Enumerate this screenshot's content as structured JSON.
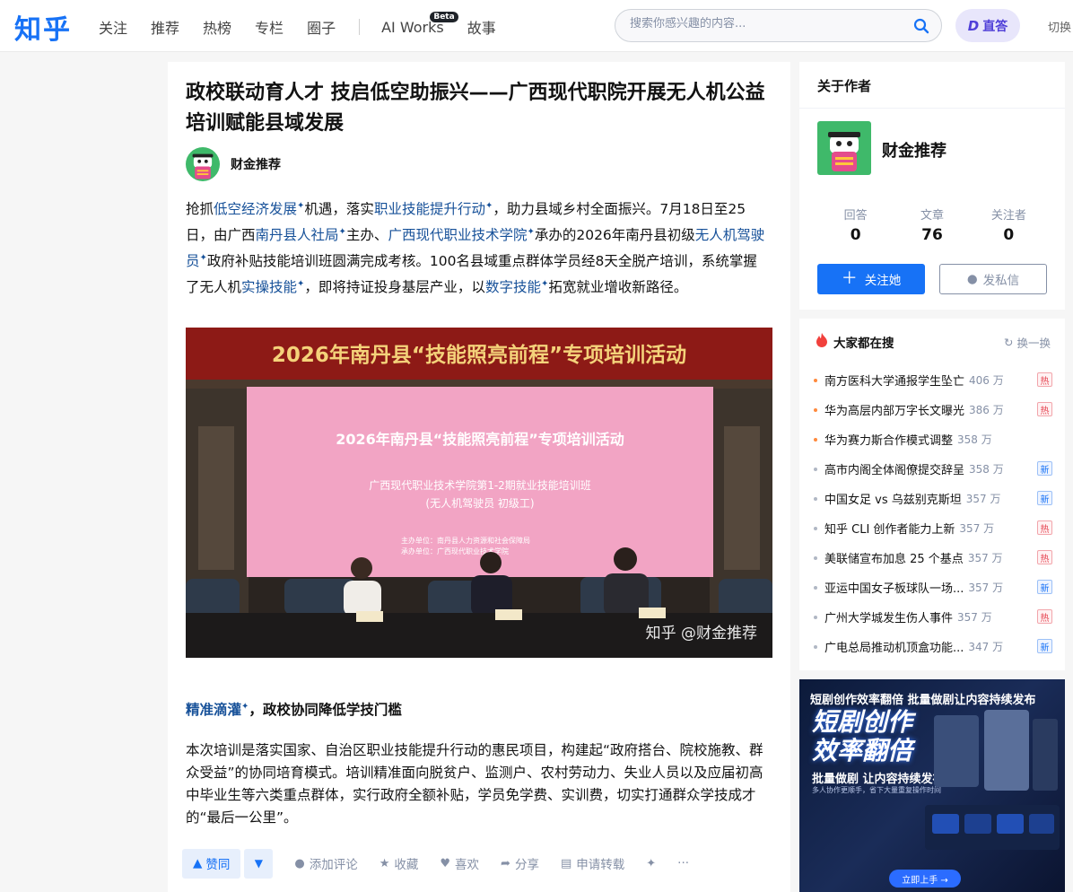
{
  "header": {
    "logo": "知乎",
    "nav": [
      "关注",
      "推荐",
      "热榜",
      "专栏",
      "圈子",
      "AI Works",
      "故事"
    ],
    "beta_badge": "Beta",
    "search_placeholder": "搜索你感兴趣的内容...",
    "zhida_mark": "D",
    "zhida_label": "直答",
    "switch_label": "切换"
  },
  "article": {
    "title": "政校联动育人才 技启低空助振兴——广西现代职院开展无人机公益培训赋能县域发展",
    "author": "财金推荐",
    "p1": [
      {
        "t": "抢抓"
      },
      {
        "t": "低空经济发展",
        "link": true
      },
      {
        "t": "机遇，落实"
      },
      {
        "t": "职业技能提升行动",
        "link": true
      },
      {
        "t": "，助力县域乡村全面振兴。7月18日至25日，由广西"
      },
      {
        "t": "南丹县人社局",
        "link": true
      },
      {
        "t": "主办、"
      },
      {
        "t": "广西现代职业技术学院",
        "link": true
      },
      {
        "t": "承办的2026年南丹县初级"
      },
      {
        "t": "无人机驾驶员",
        "link": true
      },
      {
        "t": "政府补贴技能培训班圆满完成考核。100名县域重点群体学员经8天全脱产培训，系统掌握了无人机"
      },
      {
        "t": "实操技能",
        "link": true
      },
      {
        "t": "，即将持证投身基层产业，以"
      },
      {
        "t": "数字技能",
        "link": true
      },
      {
        "t": "拓宽就业增收新路径。"
      }
    ],
    "photo": {
      "banner": "2026年南丹县“技能照亮前程”专项培训活动",
      "screen_title": "2026年南丹县“技能照亮前程”专项培训活动",
      "screen_line2": "广西现代职业技术学院第1-2期就业技能培训班",
      "screen_line3": "(无人机驾驶员 初级工)",
      "screen_line4": "主办单位：南丹县人力资源和社会保障局",
      "screen_line5": "承办单位：广西现代职业技术学院",
      "watermark": "知乎 @财金推荐"
    },
    "section_link": "精准滴灌",
    "section_rest": "，政校协同降低学技门槛",
    "p2": "本次培训是落实国家、自治区职业技能提升行动的惠民项目，构建起“政府搭台、院校施教、群众受益”的协同培育模式。培训精准面向脱贫户、监测户、农村劳动力、失业人员以及应届初高中毕业生等六类重点群体，实行政府全额补贴，学员免学费、实训费，切实打通群众学技成才的“最后一公里”。",
    "actions": {
      "upvote": "赞同",
      "comment": "添加评论",
      "collect": "收藏",
      "like": "喜欢",
      "share": "分享",
      "repost": "申请转载",
      "more": "···"
    }
  },
  "author_card": {
    "heading": "关于作者",
    "name": "财金推荐",
    "stats": [
      {
        "label": "回答",
        "value": "0"
      },
      {
        "label": "文章",
        "value": "76"
      },
      {
        "label": "关注者",
        "value": "0"
      }
    ],
    "follow": "关注她",
    "message": "发私信"
  },
  "hot": {
    "heading": "大家都在搜",
    "refresh": "换一换",
    "items": [
      {
        "title": "南方医科大学通报学生坠亡",
        "count": "406 万",
        "badge": "热",
        "dot": "#ff8a3d"
      },
      {
        "title": "华为高层内部万字长文曝光",
        "count": "386 万",
        "badge": "热",
        "dot": "#ff8a3d"
      },
      {
        "title": "华为赛力斯合作模式调整",
        "count": "358 万",
        "badge": "",
        "dot": "#ff8a3d"
      },
      {
        "title": "高市内阁全体阁僚提交辞呈",
        "count": "358 万",
        "badge": "新",
        "dot": "#b0b7c4"
      },
      {
        "title": "中国女足 vs 乌兹别克斯坦",
        "count": "357 万",
        "badge": "新",
        "dot": "#b0b7c4"
      },
      {
        "title": "知乎 CLI 创作者能力上新",
        "count": "357 万",
        "badge": "热",
        "dot": "#b0b7c4"
      },
      {
        "title": "美联储宣布加息 25 个基点",
        "count": "357 万",
        "badge": "热",
        "dot": "#b0b7c4"
      },
      {
        "title": "亚运中国女子板球队一场...",
        "count": "357 万",
        "badge": "新",
        "dot": "#b0b7c4"
      },
      {
        "title": "广州大学城发生伤人事件",
        "count": "357 万",
        "badge": "热",
        "dot": "#b0b7c4"
      },
      {
        "title": "广电总局推动机顶盒功能...",
        "count": "347 万",
        "badge": "新",
        "dot": "#b0b7c4"
      }
    ]
  },
  "ad": {
    "top": "短剧创作效率翻倍 批量做剧让内容持续发布",
    "big1": "短剧创作",
    "big2": "效率翻倍",
    "sub": "批量做剧 让内容持续发布",
    "sub2": "多人协作更顺手，省下大量重复操作时间",
    "cta": "立即上手 →"
  }
}
